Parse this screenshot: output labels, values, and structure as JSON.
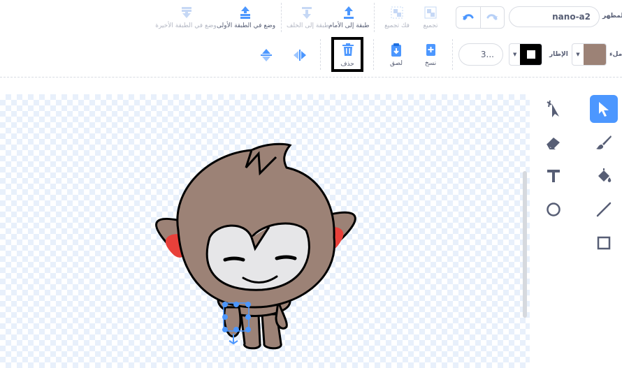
{
  "header": {
    "costume_label": "المظهر",
    "costume_name": "nano-a2",
    "fill_label": "ملء",
    "outline_label": "الإطار",
    "outline_width": "3..."
  },
  "toolbar": {
    "group": "تجميع",
    "ungroup": "فك تجميع",
    "forward": "طبقة إلى الأمام",
    "backward": "طبقة إلى الخلف",
    "front": "وضع في الطبقة الأولى",
    "back": "وضع في الطبقة الأخيرة",
    "copy": "نسخ",
    "paste": "لصق",
    "delete": "حذف"
  },
  "colors": {
    "accent": "#4c97ff",
    "fill_swatch": "#9c8276",
    "outline_swatch": "#000000",
    "text": "#575e75"
  },
  "tools": [
    "reshape-icon",
    "select-icon",
    "eraser-icon",
    "brush-icon",
    "text-icon",
    "fill-icon",
    "circle-icon",
    "line-icon",
    "rectangle-icon"
  ]
}
